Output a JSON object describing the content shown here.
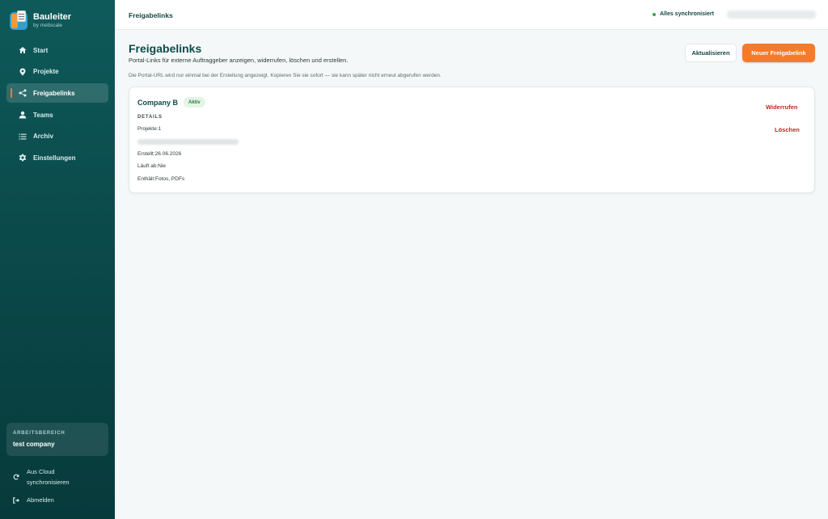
{
  "brand": {
    "title": "Bauleiter",
    "subtitle": "by metiscale"
  },
  "sidebar": {
    "items": [
      {
        "label": "Start",
        "icon": "home-icon"
      },
      {
        "label": "Projekte",
        "icon": "pin-icon"
      },
      {
        "label": "Freigabelinks",
        "icon": "share-icon",
        "active": true
      },
      {
        "label": "Teams",
        "icon": "user-icon"
      },
      {
        "label": "Archiv",
        "icon": "list-icon"
      },
      {
        "label": "Einstellungen",
        "icon": "gear-icon"
      }
    ],
    "workspace": {
      "label": "ARBEITSBEREICH",
      "name": "test company"
    },
    "sync": {
      "line1": "Aus Cloud",
      "line2": "synchronisieren"
    },
    "logout": "Abmelden"
  },
  "topbar": {
    "title": "Freigabelinks",
    "status": "Alles synchronisiert"
  },
  "main": {
    "title": "Freigabelinks",
    "subtitle": "Portal-Links für externe Auftraggeber anzeigen, widerrufen, löschen und erstellen.",
    "hint": "Die Portal-URL wird nur einmal bei der Erstellung angezeigt. Kopieren Sie sie sofort — sie kann später nicht erneut abgerufen werden.",
    "refresh_label": "Aktualisieren",
    "new_label": "Neuer Freigabelink"
  },
  "card": {
    "company": "Company B",
    "status": "Aktiv",
    "details_label": "DETAILS",
    "projects": "Projekte:1",
    "created": "Erstellt:26.06.2026",
    "expires": "Läuft ab:Nie",
    "contains": "Enthält:Fotos, PDFs",
    "revoke_label": "Widerrufen",
    "delete_label": "Löschen"
  },
  "colors": {
    "accent": "#f57a2a",
    "sidebar": "#0b4a4b",
    "danger": "#c0281f",
    "success": "#2fa552"
  }
}
